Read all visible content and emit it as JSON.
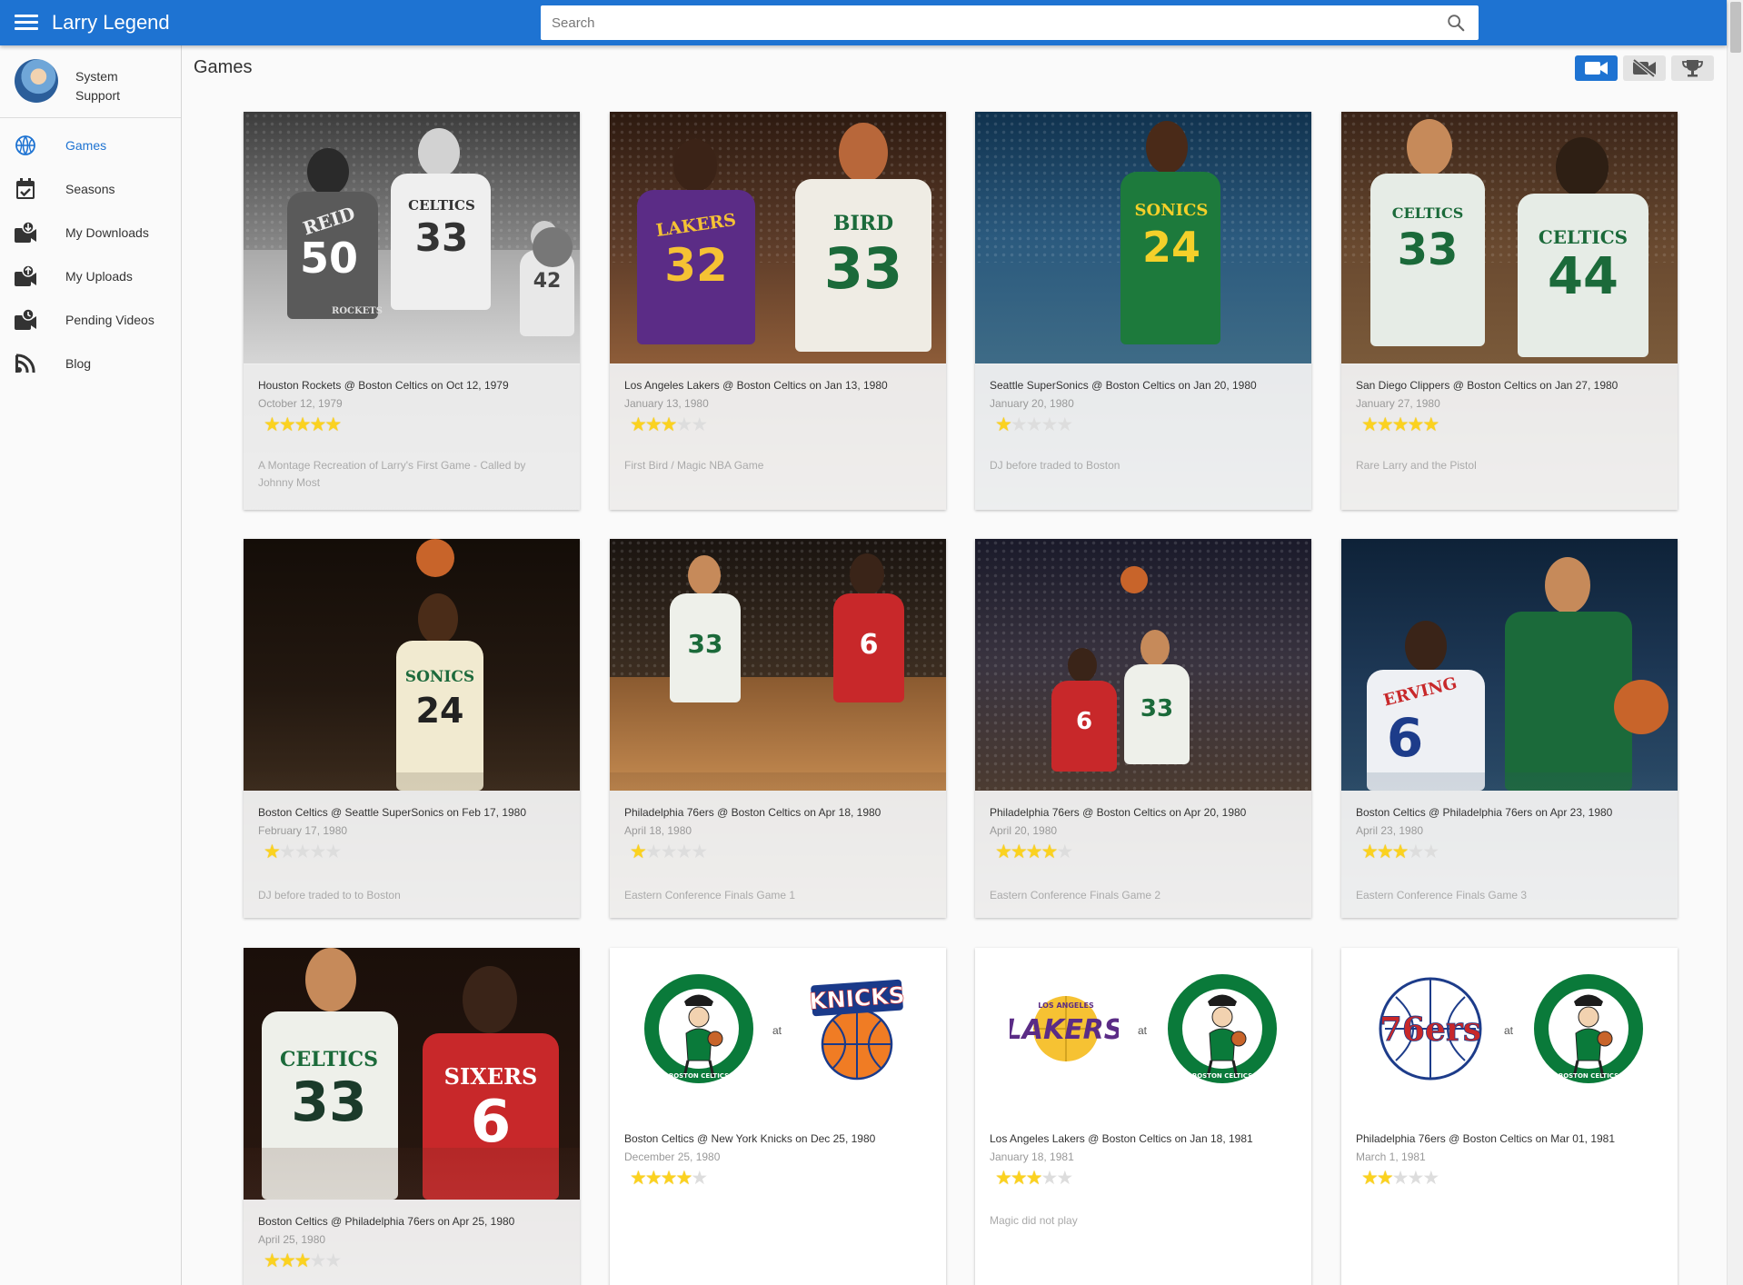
{
  "app": {
    "title": "Larry Legend"
  },
  "search": {
    "placeholder": "Search"
  },
  "profile": {
    "name_line1": "System",
    "name_line2": "Support"
  },
  "sidebar": {
    "items": [
      {
        "label": "Games",
        "icon": "basketball-icon",
        "active": true
      },
      {
        "label": "Seasons",
        "icon": "calendar-check-icon",
        "active": false
      },
      {
        "label": "My Downloads",
        "icon": "video-download-icon",
        "active": false
      },
      {
        "label": "My Uploads",
        "icon": "video-upload-icon",
        "active": false
      },
      {
        "label": "Pending Videos",
        "icon": "video-pending-icon",
        "active": false
      },
      {
        "label": "Blog",
        "icon": "blog-icon",
        "active": false
      }
    ]
  },
  "main": {
    "title": "Games",
    "view_buttons": [
      {
        "icon": "video-camera-icon",
        "active": true
      },
      {
        "icon": "video-off-icon",
        "active": false
      },
      {
        "icon": "trophy-icon",
        "active": false
      }
    ]
  },
  "colors": {
    "accent": "#1e73d2",
    "star": "#fbd21f",
    "celtics_green": "#0a7a3a"
  },
  "games": [
    {
      "title": "Houston Rockets @ Boston Celtics on Oct 12, 1979",
      "date": "October 12, 1979",
      "rating": 5,
      "description": "A Montage Recreation of Larry's First Game - Called by Johnny Most"
    },
    {
      "title": "Los Angeles Lakers @ Boston Celtics on Jan 13, 1980",
      "date": "January 13, 1980",
      "rating": 3,
      "description": "First Bird / Magic NBA Game"
    },
    {
      "title": "Seattle SuperSonics @ Boston Celtics on Jan 20, 1980",
      "date": "January 20, 1980",
      "rating": 1,
      "description": "DJ before traded to Boston"
    },
    {
      "title": "San Diego Clippers @ Boston Celtics on Jan 27, 1980",
      "date": "January 27, 1980",
      "rating": 5,
      "description": "Rare Larry and the Pistol"
    },
    {
      "title": "Boston Celtics @ Seattle SuperSonics on Feb 17, 1980",
      "date": "February 17, 1980",
      "rating": 1,
      "description": "DJ before traded to to Boston"
    },
    {
      "title": "Philadelphia 76ers @ Boston Celtics on Apr 18, 1980",
      "date": "April 18, 1980",
      "rating": 1,
      "description": "Eastern Conference Finals Game 1"
    },
    {
      "title": "Philadelphia 76ers @ Boston Celtics on Apr 20, 1980",
      "date": "April 20, 1980",
      "rating": 4,
      "description": "Eastern Conference Finals Game 2"
    },
    {
      "title": "Boston Celtics @ Philadelphia 76ers on Apr 23, 1980",
      "date": "April 23, 1980",
      "rating": 3,
      "description": "Eastern Conference Finals Game 3"
    },
    {
      "title": "Boston Celtics @ Philadelphia 76ers on Apr 25, 1980",
      "date": "April 25, 1980",
      "rating": 3,
      "description": ""
    },
    {
      "title": "Boston Celtics @ New York Knicks on Dec 25, 1980",
      "date": "December 25, 1980",
      "rating": 4,
      "description": "",
      "away_logo": "KNICKS",
      "at_label": "at"
    },
    {
      "title": "Los Angeles Lakers @ Boston Celtics on Jan 18, 1981",
      "date": "January 18, 1981",
      "rating": 3,
      "description": "Magic did not play",
      "away_logo": "LAKERS",
      "at_label": "at"
    },
    {
      "title": "Philadelphia 76ers @ Boston Celtics on Mar 01, 1981",
      "date": "March 1, 1981",
      "rating": 2,
      "description": "",
      "away_logo": "76ers",
      "at_label": "at"
    }
  ],
  "jerseys": {
    "rockets_name": "REID",
    "rockets_num": "50",
    "rockets_court": "ROCKETS",
    "celtics_word": "CELTICS",
    "bird_num": "33",
    "bird_name": "BIRD",
    "lakers_word": "LAKERS",
    "magic_num": "32",
    "sonics_word": "SONICS",
    "dj_num": "24",
    "celtics_num_44": "44",
    "celtics_num_42": "42",
    "sixers_word": "SIXERS",
    "erving_num": "6",
    "erving_name": "ERVING"
  },
  "logos": {
    "celtics_ring": "BOSTON CELTICS",
    "lakers_top": "LOS ANGELES",
    "lakers_word": "LAKERS",
    "knicks_word": "KNICKS",
    "sixers_word": "76ers"
  }
}
